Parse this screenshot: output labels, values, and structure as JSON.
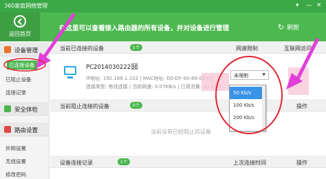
{
  "window": {
    "title": "360家庭网络管理"
  },
  "header": {
    "back_label": "返回首页",
    "banner": "在这里可以查看接入路由器的所有设备，并对设备进行管理",
    "refresh_label": "刷新"
  },
  "sidebar": {
    "sections": [
      {
        "label": "设备管理",
        "icon": "device-icon",
        "color": "#e8742a",
        "items": [
          "已连接设备",
          "已阻止设备",
          "连接记录"
        ]
      },
      {
        "label": "安全体检",
        "icon": "shield-icon",
        "color": "#49b54c",
        "items": []
      },
      {
        "label": "路由设置",
        "icon": "router-icon",
        "color": "#e04848",
        "items": [
          "外网设置",
          "无线设置",
          "修改密码"
        ]
      }
    ]
  },
  "connected": {
    "title": "当前已连接的设备",
    "count": "1个",
    "col_speed": "网速限制",
    "col_internet": "互联网访问",
    "device": {
      "name": "PC201403022238",
      "ip_line": "IP地址: 192.168.1.102 | MAC地址: D0-DF-9A-89-03-F2",
      "type_line": "连接类型: 有线连接 | 当前网速: 0.07KB/s | 已用流量: 43.15M",
      "speed_limit": "未限制"
    }
  },
  "blocked": {
    "title": "当前阻止连接的设备",
    "count": "0个",
    "col_action": "操作",
    "empty_text": "当前没有已经阻止的设备"
  },
  "records": {
    "title": "设备连接记录",
    "count": "1个",
    "col_last": "上次连接时间",
    "col_action": "操作"
  },
  "speed_dropdown": {
    "options": [
      "50 Kb/s",
      "100 Kb/s",
      "200 Kb/s"
    ],
    "highlighted": "50 Kb/s"
  },
  "colors": {
    "brand": "#4cb84f",
    "accent_blue": "#2aa7e0",
    "annotation": "#e0232f",
    "arrow": "#e040d8"
  }
}
